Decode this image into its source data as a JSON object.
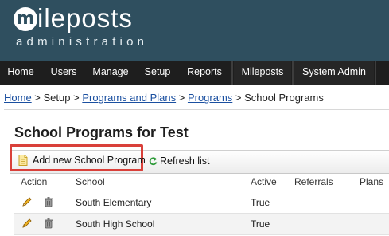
{
  "header": {
    "logo_initial": "m",
    "logo_word": "ileposts",
    "logo_sub": "administration"
  },
  "nav": {
    "items": [
      {
        "label": "Home"
      },
      {
        "label": "Users"
      },
      {
        "label": "Manage"
      },
      {
        "label": "Setup"
      },
      {
        "label": "Reports"
      },
      {
        "label": "Mileposts"
      },
      {
        "label": "System Admin"
      }
    ]
  },
  "breadcrumb": {
    "home": "Home",
    "sep": " > ",
    "setup": "Setup",
    "programs_and_plans": "Programs and Plans",
    "programs": "Programs",
    "current": "School Programs"
  },
  "page": {
    "title": "School Programs for Test"
  },
  "toolbar": {
    "add_label": "Add new School Program",
    "refresh_label": "Refresh list"
  },
  "table": {
    "headers": {
      "action": "Action",
      "school": "School",
      "active": "Active",
      "referrals": "Referrals",
      "plans": "Plans"
    },
    "rows": [
      {
        "school": "South Elementary",
        "active": "True"
      },
      {
        "school": "South High School",
        "active": "True"
      }
    ]
  },
  "colors": {
    "header_bg": "#2f4f5f",
    "nav_bg": "#1e1e1e",
    "link": "#1a4fa0",
    "highlight": "#d9403a"
  },
  "icons": [
    "edit-pencil-icon",
    "trash-icon",
    "page-icon",
    "refresh-icon"
  ]
}
